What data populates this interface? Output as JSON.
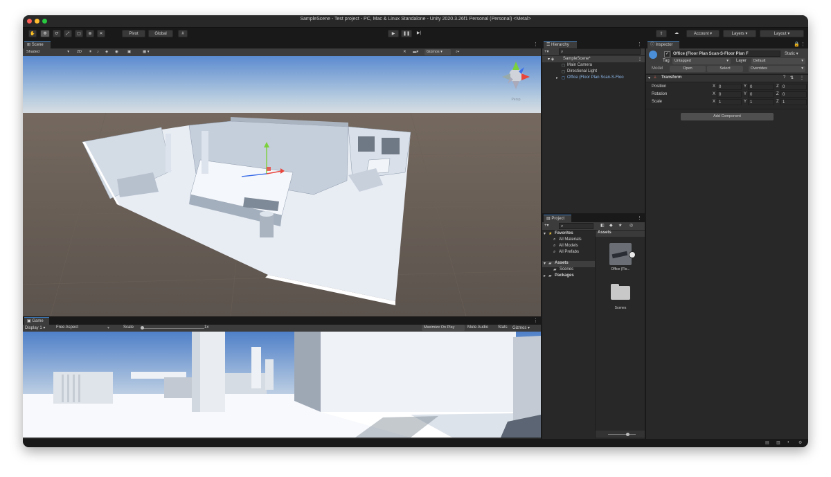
{
  "window": {
    "title": "SampleScene - Test project - PC, Mac & Linux Standalone - Unity 2020.3.26f1 Personal (Personal) <Metal>"
  },
  "toolbar": {
    "pivot_label": "Pivot",
    "global_label": "Global",
    "account_label": "Account",
    "layers_label": "Layers",
    "layout_label": "Layout"
  },
  "scene": {
    "tab_label": "Scene",
    "shading_mode": "Shaded",
    "mode_2d": "2D",
    "gizmos_label": "Gizmos",
    "persp_label": "Persp"
  },
  "game": {
    "tab_label": "Game",
    "display": "Display 1",
    "aspect": "Free Aspect",
    "scale_label": "Scale",
    "scale_value": "1x",
    "maximize_label": "Maximize On Play",
    "mute_label": "Mute Audio",
    "stats_label": "Stats",
    "gizmos_label": "Gizmos"
  },
  "hierarchy": {
    "tab_label": "Hierarchy",
    "scene_name": "SampleScene*",
    "items": [
      {
        "label": "Main Camera"
      },
      {
        "label": "Directional Light"
      },
      {
        "label": "Office (Floor Plan Scan-S-Floo"
      }
    ]
  },
  "project": {
    "tab_label": "Project",
    "favorites_label": "Favorites",
    "favorites": [
      {
        "label": "All Materials"
      },
      {
        "label": "All Models"
      },
      {
        "label": "All Prefabs"
      }
    ],
    "assets_label": "Assets",
    "assets_children": [
      {
        "label": "Scenes"
      }
    ],
    "packages_label": "Packages",
    "breadcrumb": "Assets",
    "grid_items": [
      {
        "label": "Office (Flo..."
      },
      {
        "label": "Scenes"
      }
    ]
  },
  "inspector": {
    "tab_label": "Inspector",
    "object_name": "Office (Floor Plan Scan-S-Floor Plan F",
    "static_label": "Static",
    "tag_label": "Tag",
    "tag_value": "Untagged",
    "layer_label": "Layer",
    "layer_value": "Default",
    "model_label": "Model",
    "open_label": "Open",
    "select_label": "Select",
    "overrides_label": "Overrides",
    "transform_label": "Transform",
    "position_label": "Position",
    "rotation_label": "Rotation",
    "scale_label": "Scale",
    "axis_x": "X",
    "axis_y": "Y",
    "axis_z": "Z",
    "position": {
      "x": "0",
      "y": "0",
      "z": "0"
    },
    "rotation": {
      "x": "0",
      "y": "0",
      "z": "0"
    },
    "scale": {
      "x": "1",
      "y": "1",
      "z": "1"
    },
    "add_component_label": "Add Component"
  },
  "colors": {
    "accent": "#3a79bb",
    "panel_bg": "#282828",
    "toolbar_bg": "#191919",
    "sky_top": "#5b8bd0",
    "ground": "#635a53"
  }
}
